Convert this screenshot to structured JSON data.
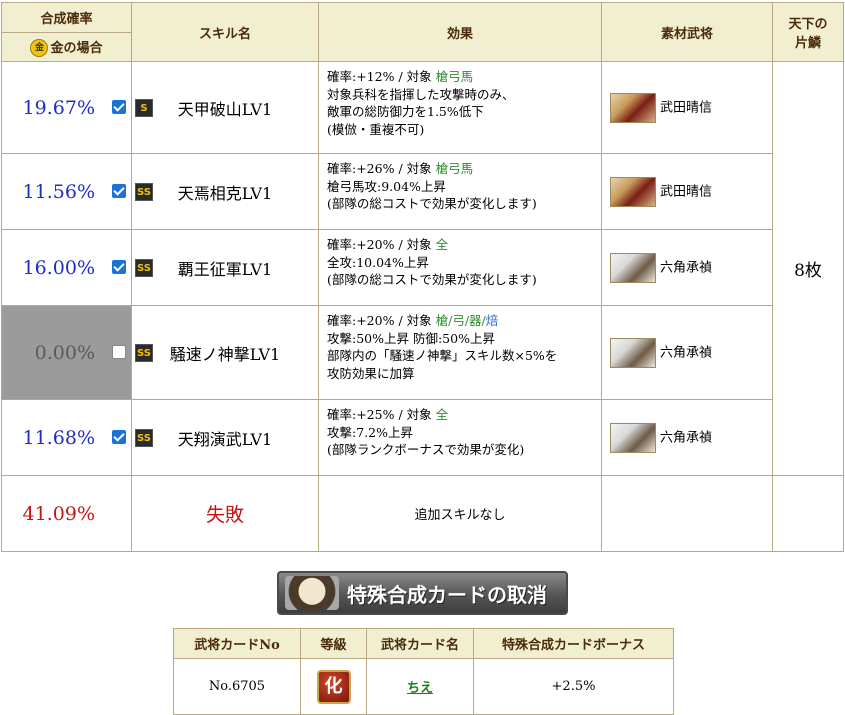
{
  "header": {
    "rate": "合成確率",
    "gold_icon": "金",
    "gold_case": "金の場合",
    "skill_name": "スキル名",
    "effect": "効果",
    "material": "素材武将",
    "tenka_line1": "天下の",
    "tenka_line2": "片鱗"
  },
  "tenka_value": "8枚",
  "rows": [
    {
      "rate": "19.67%",
      "checked": true,
      "rank": "S",
      "skill": "天甲破山LV1",
      "eff1_pre": "確率:+12% / 対象 ",
      "eff1_target": "槍弓馬",
      "eff_lines": [
        "対象兵科を指揮した攻撃時のみ、",
        "敵軍の総防御力を1.5%低下",
        "(模倣・重複不可)"
      ],
      "general": "武田晴信",
      "portrait": "shingen-portrait"
    },
    {
      "rate": "11.56%",
      "checked": true,
      "rank": "SS",
      "skill": "天焉相克LV1",
      "eff1_pre": "確率:+26% / 対象 ",
      "eff1_target": "槍弓馬",
      "eff_lines": [
        "槍弓馬攻:9.04%上昇",
        "(部隊の総コストで効果が変化します)"
      ],
      "general": "武田晴信",
      "portrait": "shingen-portrait"
    },
    {
      "rate": "16.00%",
      "checked": true,
      "rank": "SS",
      "skill": "覇王征軍LV1",
      "eff1_pre": "確率:+20% / 対象 ",
      "eff1_target": "全",
      "eff_lines": [
        "全攻:10.04%上昇",
        "(部隊の総コストで効果が変化します)"
      ],
      "general": "六角承禎",
      "portrait": "jotei-portrait"
    },
    {
      "rate": "0.00%",
      "checked": false,
      "rank": "SS",
      "skill": "騒速ノ神撃LV1",
      "eff1_pre": "確率:+20% / 対象 ",
      "eff1_target": "槍/弓/器/",
      "eff1_extra": "焙",
      "eff_lines": [
        "攻撃:50%上昇 防御:50%上昇",
        "部隊内の「騒速ノ神撃」スキル数×5%を",
        "攻防効果に加算"
      ],
      "general": "六角承禎",
      "portrait": "jotei-portrait"
    },
    {
      "rate": "11.68%",
      "checked": true,
      "rank": "SS",
      "skill": "天翔演武LV1",
      "eff1_pre": "確率:+25% / 対象 ",
      "eff1_target": "全",
      "eff_lines": [
        "攻撃:7.2%上昇",
        "(部隊ランクボーナスで効果が変化)"
      ],
      "general": "六角承禎",
      "portrait": "jotei-portrait"
    }
  ],
  "fail_row": {
    "rate": "41.09%",
    "label": "失敗",
    "note": "追加スキルなし"
  },
  "cancel_button": "特殊合成カードの取消",
  "cards_table": {
    "headers": [
      "武将カードNo",
      "等級",
      "武将カード名",
      "特殊合成カードボーナス"
    ],
    "row": {
      "no": "No.6705",
      "grade": "化",
      "name": "ちえ",
      "bonus": "+2.5%"
    }
  },
  "colors": {
    "rate_blue": "#1c2ec4",
    "fail_red": "#c41414",
    "target_green": "#2f8a2f",
    "header_bg": "#f2eed0"
  }
}
